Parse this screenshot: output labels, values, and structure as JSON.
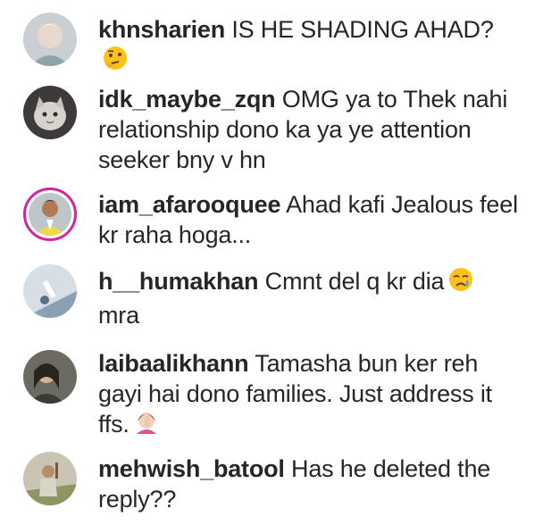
{
  "comments": [
    {
      "username": "khnsharien",
      "text": "IS HE SHADING AHAD?",
      "emoji": "thinking-face-emoji"
    },
    {
      "username": "idk_maybe_zqn",
      "text": "OMG ya to Thek nahi relationship dono ka ya ye attention seeker bny v hn",
      "emoji": ""
    },
    {
      "username": "iam_afarooquee",
      "text": "Ahad kafi Jealous feel kr raha hoga...",
      "emoji": ""
    },
    {
      "username": "h__humakhan",
      "text": "Cmnt del q kr dia",
      "text_after": "mra",
      "emoji": "crying-face-emoji"
    },
    {
      "username": "laibaalikhann",
      "text": "Tamasha bun ker reh gayi hai dono families. Just address it ffs.",
      "emoji": "woman-facepalming-emoji"
    },
    {
      "username": "mehwish_batool",
      "text": "Has he deleted the reply??",
      "emoji": ""
    }
  ]
}
